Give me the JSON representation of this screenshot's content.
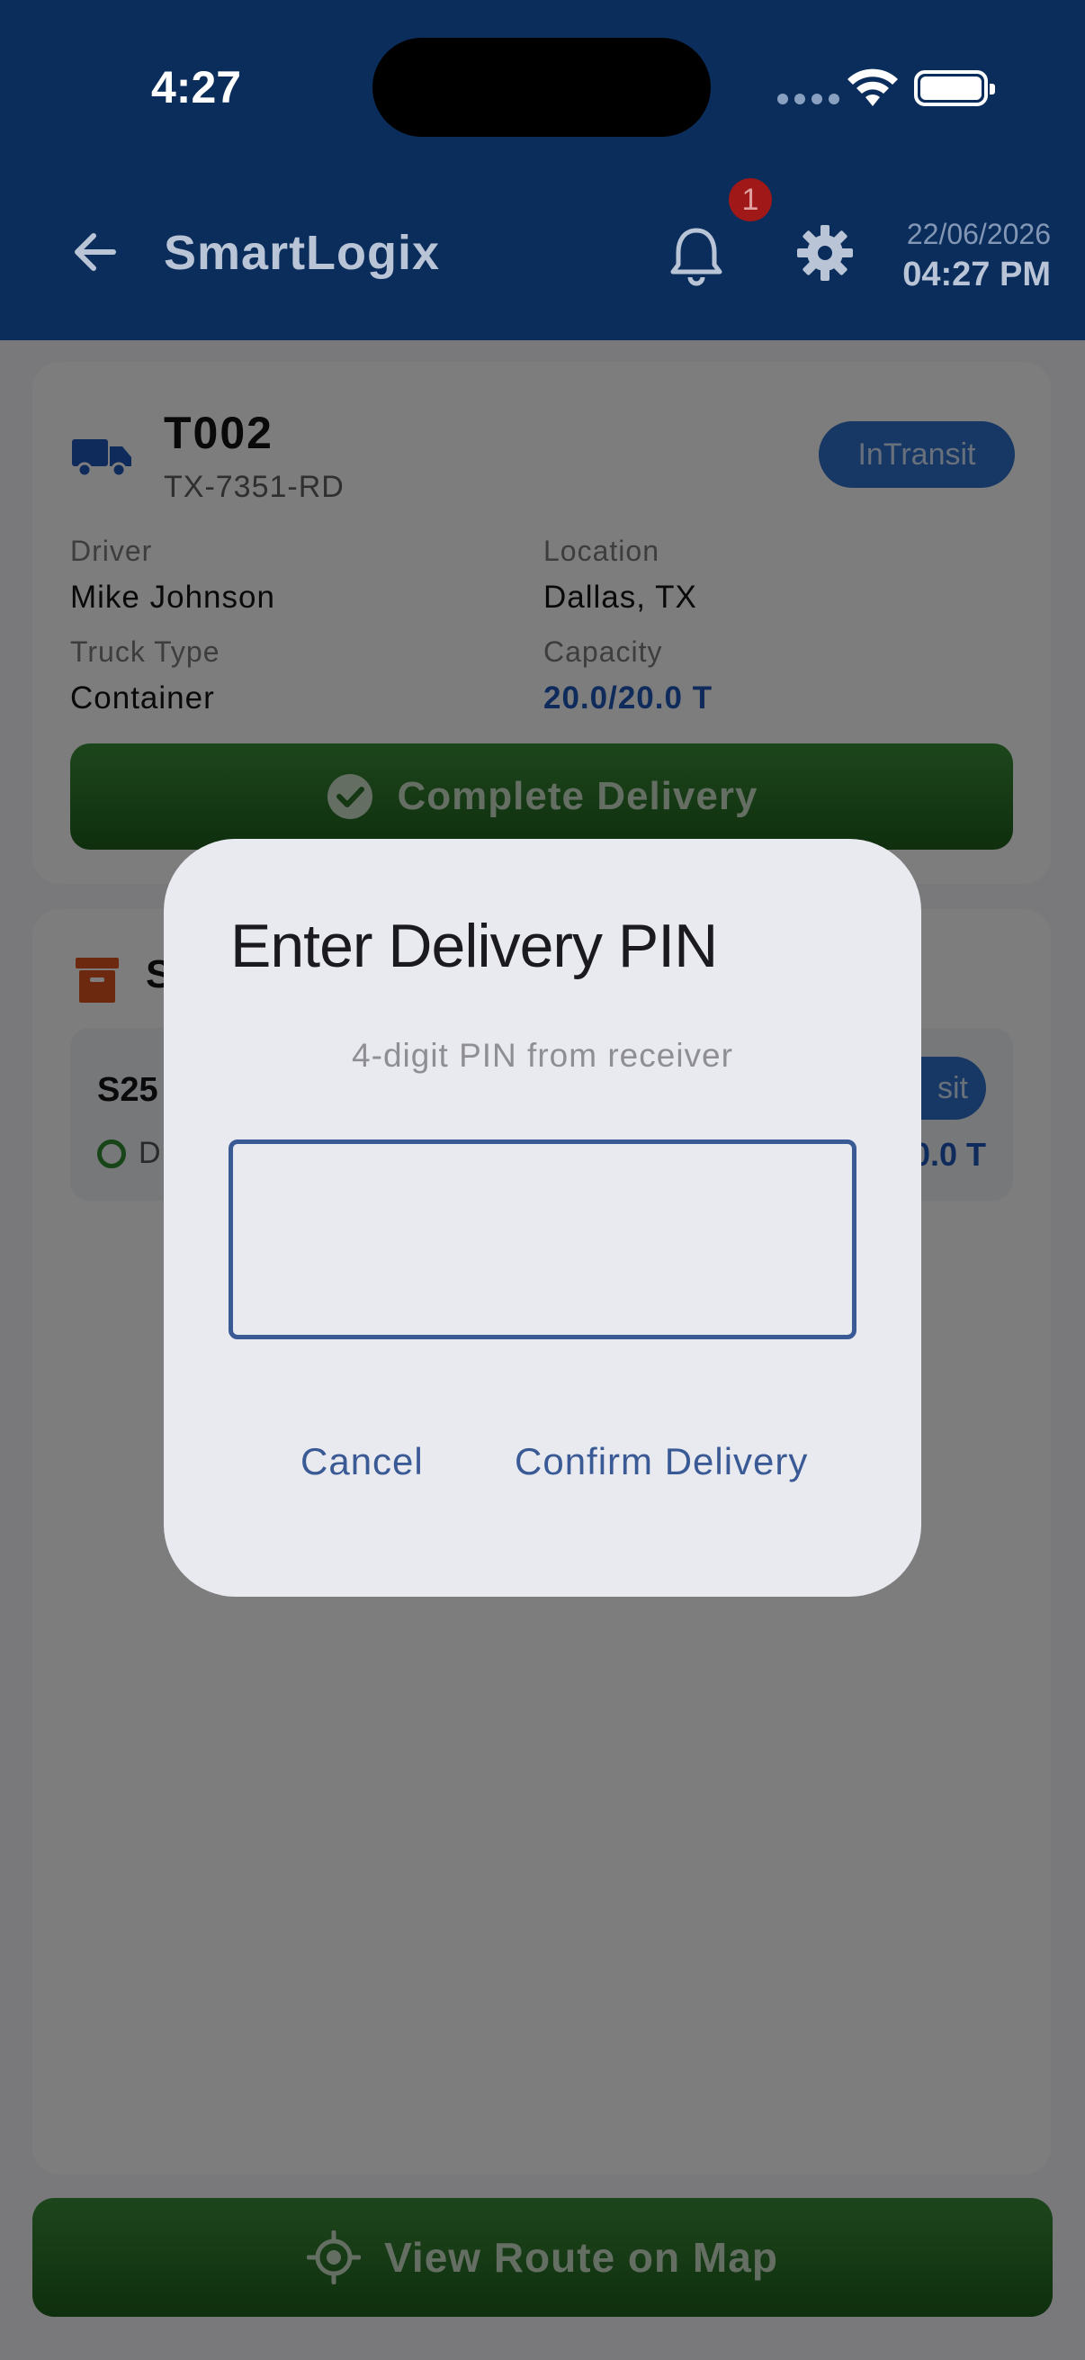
{
  "status_bar": {
    "time": "4:27"
  },
  "header": {
    "title": "SmartLogix",
    "notification_count": "1",
    "date": "22/06/2026",
    "time": "04:27 PM",
    "icons": [
      "back-arrow-icon",
      "bell-icon",
      "gear-icon"
    ]
  },
  "truck": {
    "id": "T002",
    "plate": "TX-7351-RD",
    "status": "InTransit",
    "driver_label": "Driver",
    "driver": "Mike Johnson",
    "location_label": "Location",
    "location": "Dallas, TX",
    "type_label": "Truck Type",
    "type": "Container",
    "capacity_label": "Capacity",
    "capacity": "20.0/20.0 T",
    "complete_button": "Complete Delivery"
  },
  "shipments": {
    "title_visible": "S",
    "item": {
      "id_visible": "S25",
      "status_visible": "D",
      "pill_visible": "sit",
      "weight_visible": "0.0 T"
    }
  },
  "route_button": "View Route on Map",
  "dialog": {
    "title": "Enter Delivery PIN",
    "subtitle": "4-digit PIN from receiver",
    "pin_value": "",
    "cancel": "Cancel",
    "confirm": "Confirm Delivery"
  },
  "colors": {
    "header_bg": "#0b2d5b",
    "primary_blue": "#2e6fc9",
    "success_green": "#2f7d2c",
    "badge_red": "#a01818",
    "dialog_accent": "#3a5a95"
  }
}
